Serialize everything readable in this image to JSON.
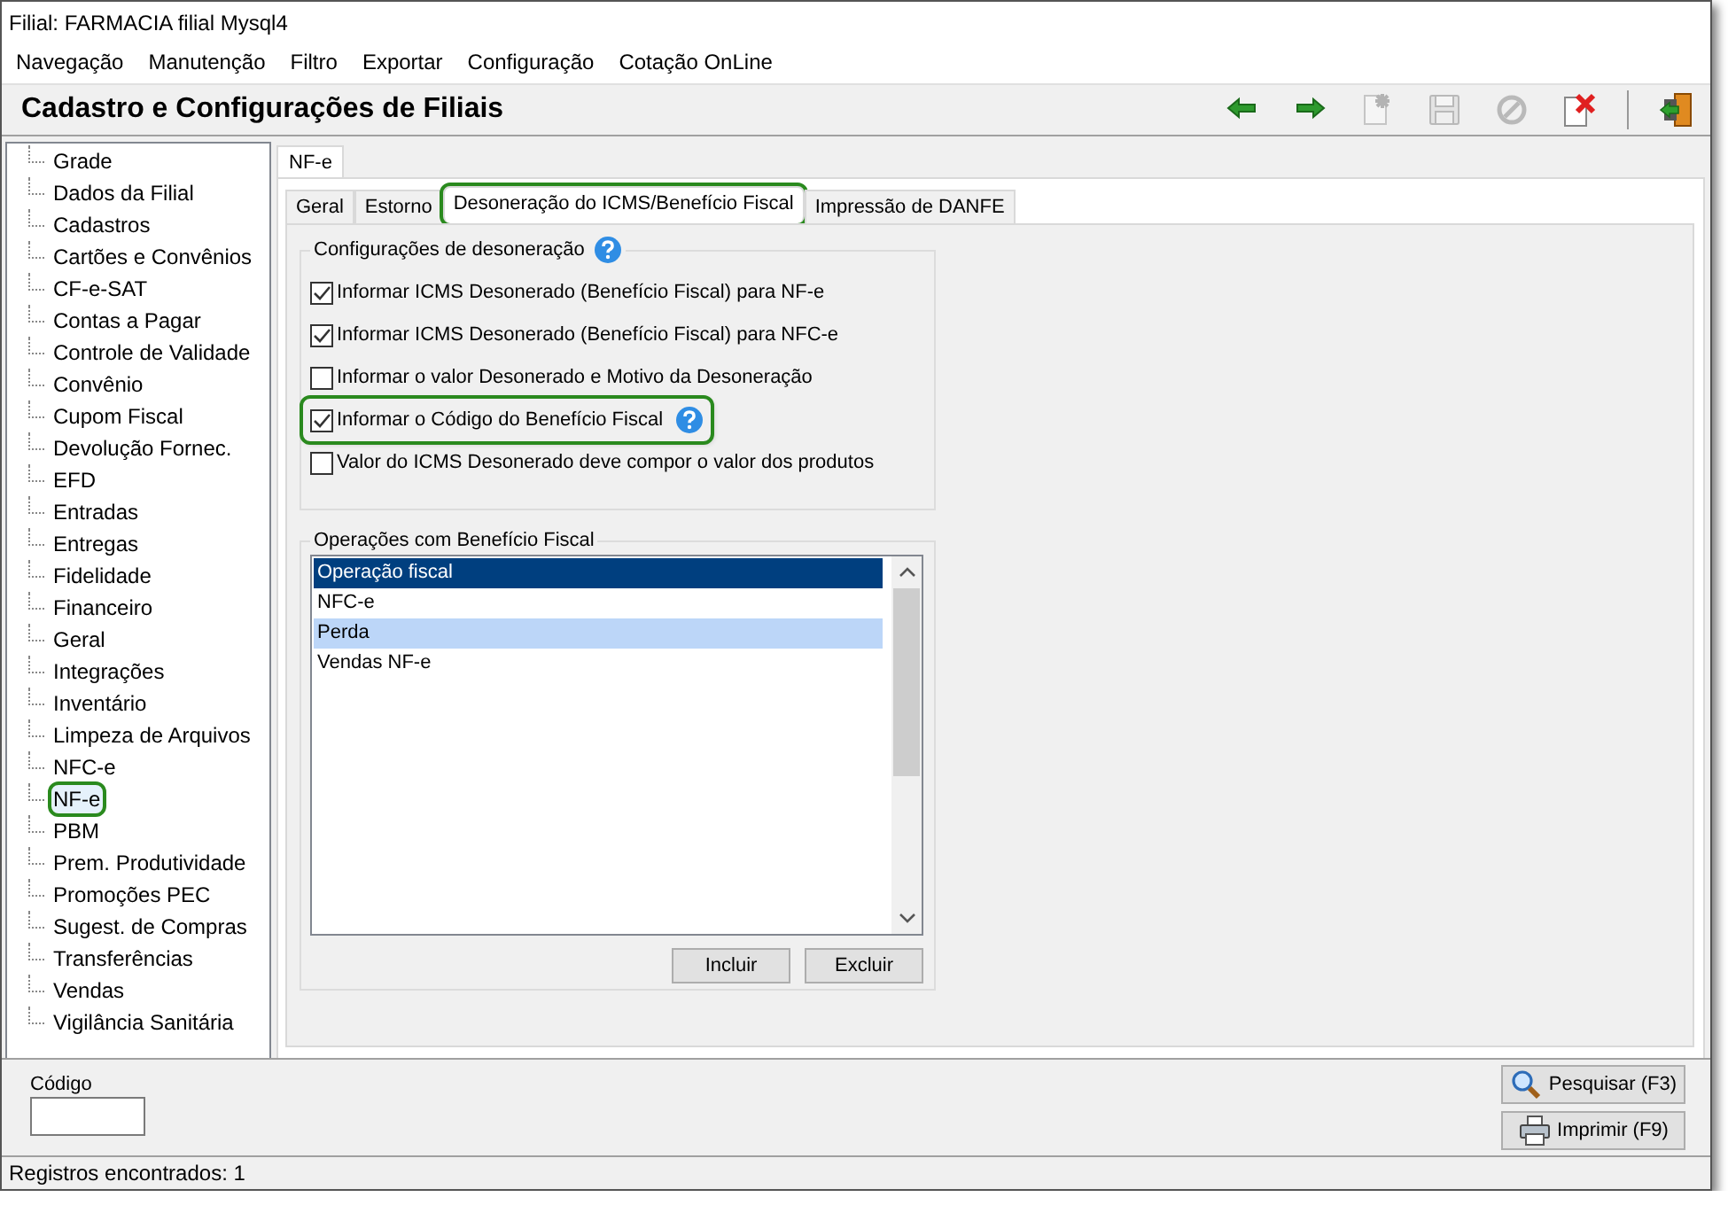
{
  "window": {
    "title": "Filial: FARMACIA filial Mysql4"
  },
  "menu": [
    "Navegação",
    "Manutenção",
    "Filtro",
    "Exportar",
    "Configuração",
    "Cotação OnLine"
  ],
  "header": {
    "title": "Cadastro e Configurações de Filiais"
  },
  "toolbar": [
    {
      "kind": "back",
      "disabled": false
    },
    {
      "kind": "forward",
      "disabled": false
    },
    {
      "kind": "new",
      "disabled": true
    },
    {
      "kind": "save",
      "disabled": true
    },
    {
      "kind": "cancel",
      "disabled": true
    },
    {
      "kind": "delete",
      "disabled": false
    },
    {
      "kind": "separator"
    },
    {
      "kind": "exit",
      "disabled": false
    }
  ],
  "sidebar": {
    "items": [
      {
        "label": "Grade",
        "selected": false,
        "highlighted": false
      },
      {
        "label": "Dados da Filial",
        "selected": false,
        "highlighted": false
      },
      {
        "label": "Cadastros",
        "selected": false,
        "highlighted": false
      },
      {
        "label": "Cartões e Convênios",
        "selected": false,
        "highlighted": false
      },
      {
        "label": "CF-e-SAT",
        "selected": false,
        "highlighted": false
      },
      {
        "label": "Contas a Pagar",
        "selected": false,
        "highlighted": false
      },
      {
        "label": "Controle de Validade",
        "selected": false,
        "highlighted": false
      },
      {
        "label": "Convênio",
        "selected": false,
        "highlighted": false
      },
      {
        "label": "Cupom Fiscal",
        "selected": false,
        "highlighted": false
      },
      {
        "label": "Devolução Fornec.",
        "selected": false,
        "highlighted": false
      },
      {
        "label": "EFD",
        "selected": false,
        "highlighted": false
      },
      {
        "label": "Entradas",
        "selected": false,
        "highlighted": false
      },
      {
        "label": "Entregas",
        "selected": false,
        "highlighted": false
      },
      {
        "label": "Fidelidade",
        "selected": false,
        "highlighted": false
      },
      {
        "label": "Financeiro",
        "selected": false,
        "highlighted": false
      },
      {
        "label": "Geral",
        "selected": false,
        "highlighted": false
      },
      {
        "label": "Integrações",
        "selected": false,
        "highlighted": false
      },
      {
        "label": "Inventário",
        "selected": false,
        "highlighted": false
      },
      {
        "label": "Limpeza de Arquivos",
        "selected": false,
        "highlighted": false
      },
      {
        "label": "NFC-e",
        "selected": false,
        "highlighted": false
      },
      {
        "label": "NF-e",
        "selected": true,
        "highlighted": true
      },
      {
        "label": "PBM",
        "selected": false,
        "highlighted": false
      },
      {
        "label": "Prem. Produtividade",
        "selected": false,
        "highlighted": false
      },
      {
        "label": "Promoções PEC",
        "selected": false,
        "highlighted": false
      },
      {
        "label": "Sugest. de Compras",
        "selected": false,
        "highlighted": false
      },
      {
        "label": "Transferências",
        "selected": false,
        "highlighted": false
      },
      {
        "label": "Vendas",
        "selected": false,
        "highlighted": false
      },
      {
        "label": "Vigilância Sanitária",
        "selected": false,
        "highlighted": false
      }
    ]
  },
  "outer_tab": {
    "label": "NF-e"
  },
  "tabs": [
    {
      "label": "Geral",
      "selected": false,
      "highlighted": false
    },
    {
      "label": "Estorno",
      "selected": false,
      "highlighted": false
    },
    {
      "label": "Desoneração do ICMS/Benefício Fiscal",
      "selected": true,
      "highlighted": true
    },
    {
      "label": "Impressão de DANFE",
      "selected": false,
      "highlighted": false
    }
  ],
  "config_group": {
    "title": "Configurações de desoneração",
    "help": true,
    "options": [
      {
        "label": "Informar ICMS Desonerado (Benefício Fiscal) para NF-e",
        "checked": true,
        "highlighted": false,
        "help": false
      },
      {
        "label": "Informar ICMS Desonerado (Benefício Fiscal) para NFC-e",
        "checked": true,
        "highlighted": false,
        "help": false
      },
      {
        "label": "Informar o valor Desonerado e Motivo da Desoneração",
        "checked": false,
        "highlighted": false,
        "help": false
      },
      {
        "label": "Informar o Código do Benefício Fiscal",
        "checked": true,
        "highlighted": true,
        "help": true
      },
      {
        "label": "Valor do ICMS Desonerado deve compor o valor dos produtos",
        "checked": false,
        "highlighted": false,
        "help": false
      }
    ]
  },
  "operations_group": {
    "title": "Operações com Benefício Fiscal",
    "rows": [
      {
        "label": "Operação fiscal",
        "selected": true,
        "hover": false
      },
      {
        "label": "NFC-e",
        "selected": false,
        "hover": false
      },
      {
        "label": "Perda",
        "selected": false,
        "hover": true
      },
      {
        "label": "Vendas NF-e",
        "selected": false,
        "hover": false
      }
    ],
    "buttons": [
      "Incluir",
      "Excluir"
    ]
  },
  "filter": {
    "label": "Código"
  },
  "actions": [
    {
      "kind": "search",
      "label": "Pesquisar (F3)"
    },
    {
      "kind": "print",
      "label": "Imprimir (F9)"
    }
  ],
  "status_bar": "Registros encontrados: 1"
}
